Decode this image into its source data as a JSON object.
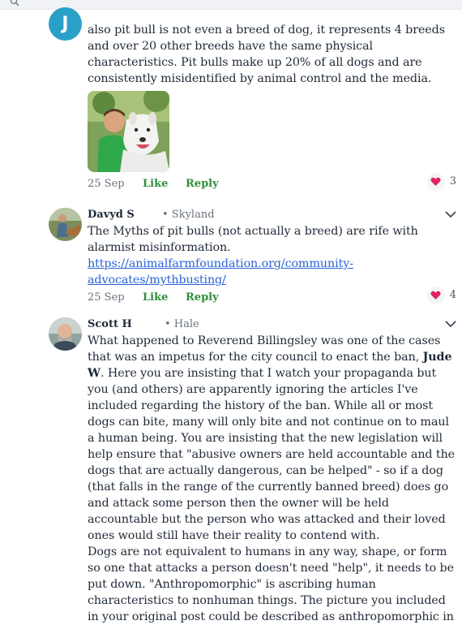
{
  "comments": [
    {
      "author_initial": "J",
      "text": "also pit bull is not even a breed of dog, it represents 4 breeds and over 20 other breeds have the same physical characteristics. Pit bulls make up 20% of all dogs and are consistently misidentified by animal control and the media.",
      "date": "25 Sep",
      "like_label": "Like",
      "reply_label": "Reply",
      "likes": "3"
    },
    {
      "author": "Davyd S",
      "location": "• Skyland",
      "text": "The Myths of pit bulls (not actually a breed) are rife with alarmist misinformation.",
      "link": "https://animalfarmfoundation.org/community-advocates/mythbusting/",
      "date": "25 Sep",
      "like_label": "Like",
      "reply_label": "Reply",
      "likes": "4"
    },
    {
      "author": "Scott H",
      "location": "• Hale",
      "text_a": "What happened to Reverend Billingsley was one of the cases that was an impetus for the city council to enact the ban, ",
      "mention": "Jude W",
      "text_b": ". Here you are insisting that I watch your propaganda but you (and others) are apparently ignoring the articles I've included regarding the history of the ban. While all or most dogs can bite, many will only bite and not continue on to maul a human being. You are insisting that the new legislation will help ensure that \"abusive owners are held accountable and the dogs that are actually dangerous, can be helped\" - so if a dog (that falls in the range of the currently banned breed) does go and attack some person then the owner will be held accountable but the person who was attacked and their loved ones would still have their reality to contend with.",
      "text_c": "Dogs are not equivalent to humans in any way, shape, or form so one that attacks a person doesn't need \"help\", it needs to be put down. \"Anthropomorphic\" is ascribing human characteristics to nonhuman things. The picture you included in your original post could be described as anthropomorphic in"
    }
  ],
  "colors": {
    "accent_green": "#2f8f3a",
    "link_blue": "#2b63d6",
    "heart_red": "#e0245e"
  }
}
